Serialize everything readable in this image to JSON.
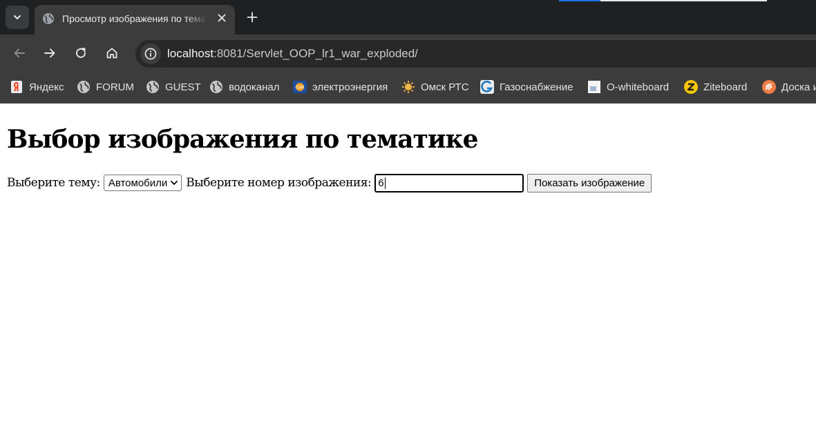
{
  "browser": {
    "tab": {
      "title": "Просмотр изображения по тематике"
    },
    "address": {
      "host": "localhost",
      "path": ":8081/Servlet_OOP_lr1_war_exploded/"
    },
    "bookmarks": [
      {
        "label": "Яндекс",
        "icon": "yandex-icon"
      },
      {
        "label": "FORUM",
        "icon": "globe-icon"
      },
      {
        "label": "GUEST",
        "icon": "globe-icon"
      },
      {
        "label": "водоканал",
        "icon": "globe-icon"
      },
      {
        "label": "электроэнергия",
        "icon": "energy-company-icon"
      },
      {
        "label": "Омск РТС",
        "icon": "sun-icon"
      },
      {
        "label": "Газоснабжение",
        "icon": "gas-company-icon"
      },
      {
        "label": "O-whiteboard",
        "icon": "document-icon"
      },
      {
        "label": "Ziteboard",
        "icon": "ziteboard-icon"
      },
      {
        "label": "Доска и",
        "icon": "board-icon"
      }
    ]
  },
  "page": {
    "heading": "Выбор изображения по тематике",
    "topic_label": "Выберите тему:",
    "topic_selected": "Автомобили",
    "number_label": "Выберите номер изображения:",
    "number_value": "6",
    "submit_label": "Показать изображение"
  },
  "colors": {
    "tabbar_bg": "#1f2021",
    "toolbar_bg": "#3c3c3c",
    "omnibox_bg": "#282828"
  }
}
